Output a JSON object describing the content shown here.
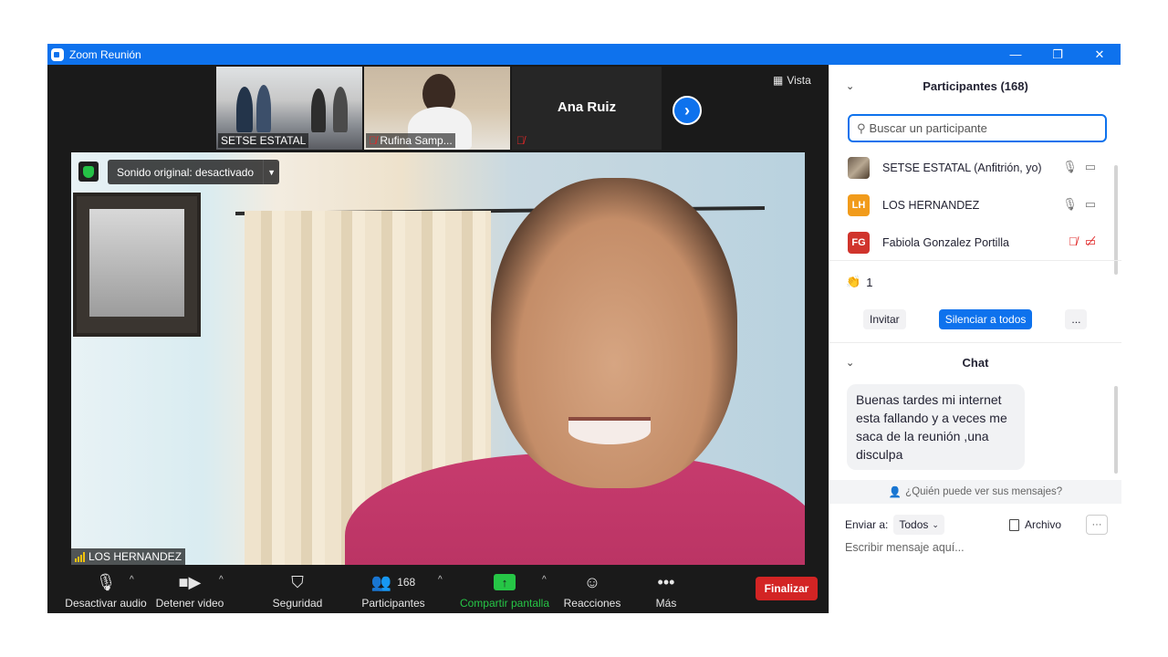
{
  "window": {
    "title": "Zoom Reunión",
    "controls": [
      "—",
      "❐",
      "✕"
    ]
  },
  "strip": {
    "thumbs": [
      {
        "name": "SETSE ESTATAL"
      },
      {
        "name": "Rufina Samp..."
      },
      {
        "name": "Ana Ruiz"
      }
    ],
    "view_label": "Vista",
    "next_glyph": "›"
  },
  "video": {
    "sound_label": "Sonido original: desactivado",
    "speaker_name": "LOS HERNANDEZ"
  },
  "toolbar": {
    "audio": "Desactivar audio",
    "video": "Detener video",
    "security": "Seguridad",
    "participants": "Participantes",
    "participants_count": "168",
    "share": "Compartir pantalla",
    "reactions": "Reacciones",
    "more": "Más",
    "end": "Finalizar"
  },
  "participants_panel": {
    "title": "Participantes (168)",
    "search_placeholder": "Buscar un participante",
    "items": [
      {
        "name": "SETSE ESTATAL (Anfitrión, yo)",
        "initials": "",
        "muted": false
      },
      {
        "name": "LOS HERNANDEZ",
        "initials": "LH",
        "muted": false
      },
      {
        "name": "Fabiola Gonzalez Portilla",
        "initials": "FG",
        "muted": true
      }
    ],
    "reaction_count": "1",
    "invite": "Invitar",
    "mute_all": "Silenciar a todos",
    "more": "..."
  },
  "chat": {
    "title": "Chat",
    "message": "Buenas tardes mi internet esta fallando y a veces me saca de la reunión ,una disculpa",
    "who_can_see": "¿Quién puede ver sus mensajes?",
    "send_to_label": "Enviar a:",
    "send_to_value": "Todos",
    "file_label": "Archivo",
    "more": "···",
    "input_placeholder": "Escribir mensaje aquí..."
  },
  "colors": {
    "accent": "#0e72ed",
    "end": "#d32424",
    "share": "#26c646",
    "muted": "#e02828"
  }
}
